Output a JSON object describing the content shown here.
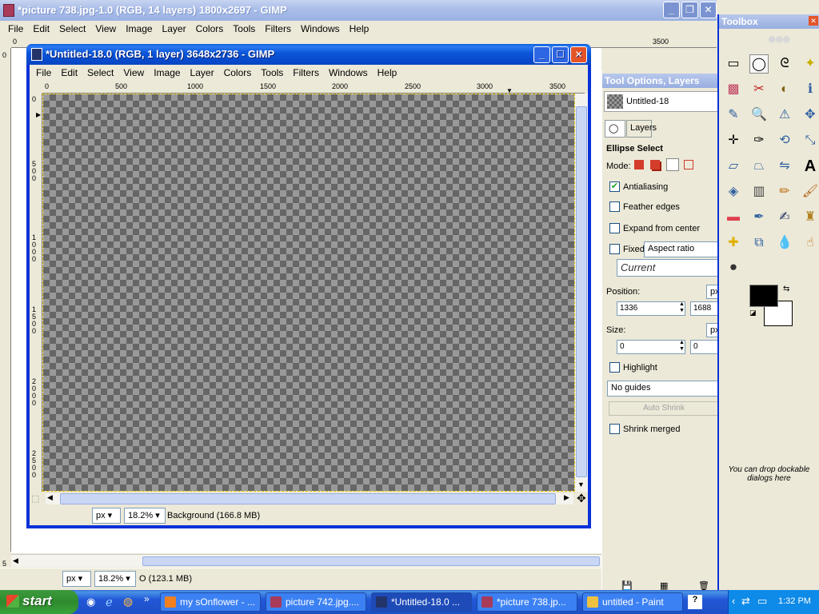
{
  "background_window": {
    "title": "*picture 738.jpg-1.0 (RGB, 14 layers) 1800x2697 - GIMP",
    "menus": [
      "File",
      "Edit",
      "Select",
      "View",
      "Image",
      "Layer",
      "Colors",
      "Tools",
      "Filters",
      "Windows",
      "Help"
    ],
    "ruler_top": [
      "0",
      "3500"
    ],
    "ruler_left": [
      "0",
      "5",
      "0"
    ],
    "unit": "px",
    "zoom": "18.2%",
    "status": "O (123.1 MB)"
  },
  "image_window": {
    "title": "*Untitled-18.0 (RGB, 1 layer) 3648x2736 - GIMP",
    "menus": [
      "File",
      "Edit",
      "Select",
      "View",
      "Image",
      "Layer",
      "Colors",
      "Tools",
      "Filters",
      "Windows",
      "Help"
    ],
    "ruler_top": [
      "0",
      "500",
      "1000",
      "1500",
      "2000",
      "2500",
      "3000",
      "3500"
    ],
    "ruler_left": [
      "0",
      "500",
      "1000",
      "1500",
      "2000",
      "2500"
    ],
    "unit": "px",
    "zoom": "18.2%",
    "status": "Background (166.8 MB)"
  },
  "dock": {
    "title": "Tool Options, Layers",
    "image_name": "Untitled-18",
    "tab_layers": "Layers",
    "tool_name": "Ellipse Select",
    "mode_label": "Mode:",
    "antialiasing": {
      "label": "Antialiasing",
      "checked": true
    },
    "feather": {
      "label": "Feather edges",
      "checked": false
    },
    "expand": {
      "label": "Expand from center",
      "checked": false
    },
    "fixed": {
      "label": "Fixed:",
      "checked": false,
      "value": "Aspect ratio"
    },
    "current": "Current",
    "position_label": "Position:",
    "position_unit": "px",
    "position_x": "1336",
    "position_y": "1688",
    "size_label": "Size:",
    "size_unit": "px",
    "size_w": "0",
    "size_h": "0",
    "highlight": {
      "label": "Highlight",
      "checked": false
    },
    "guides": "No guides",
    "auto_shrink": "Auto Shrink",
    "shrink_merged": {
      "label": "Shrink merged",
      "checked": false
    }
  },
  "toolbox": {
    "title": "Toolbox",
    "drop_hint": "You can drop dockable dialogs here",
    "fg_color": "#000000",
    "bg_color": "#ffffff"
  },
  "taskbar": {
    "start": "start",
    "tasks": [
      "my sOnflower - ...",
      "picture 742.jpg....",
      "*Untitled-18.0 ...",
      "*picture 738.jp...",
      "untitled - Paint"
    ],
    "clock": "1:32 PM"
  }
}
